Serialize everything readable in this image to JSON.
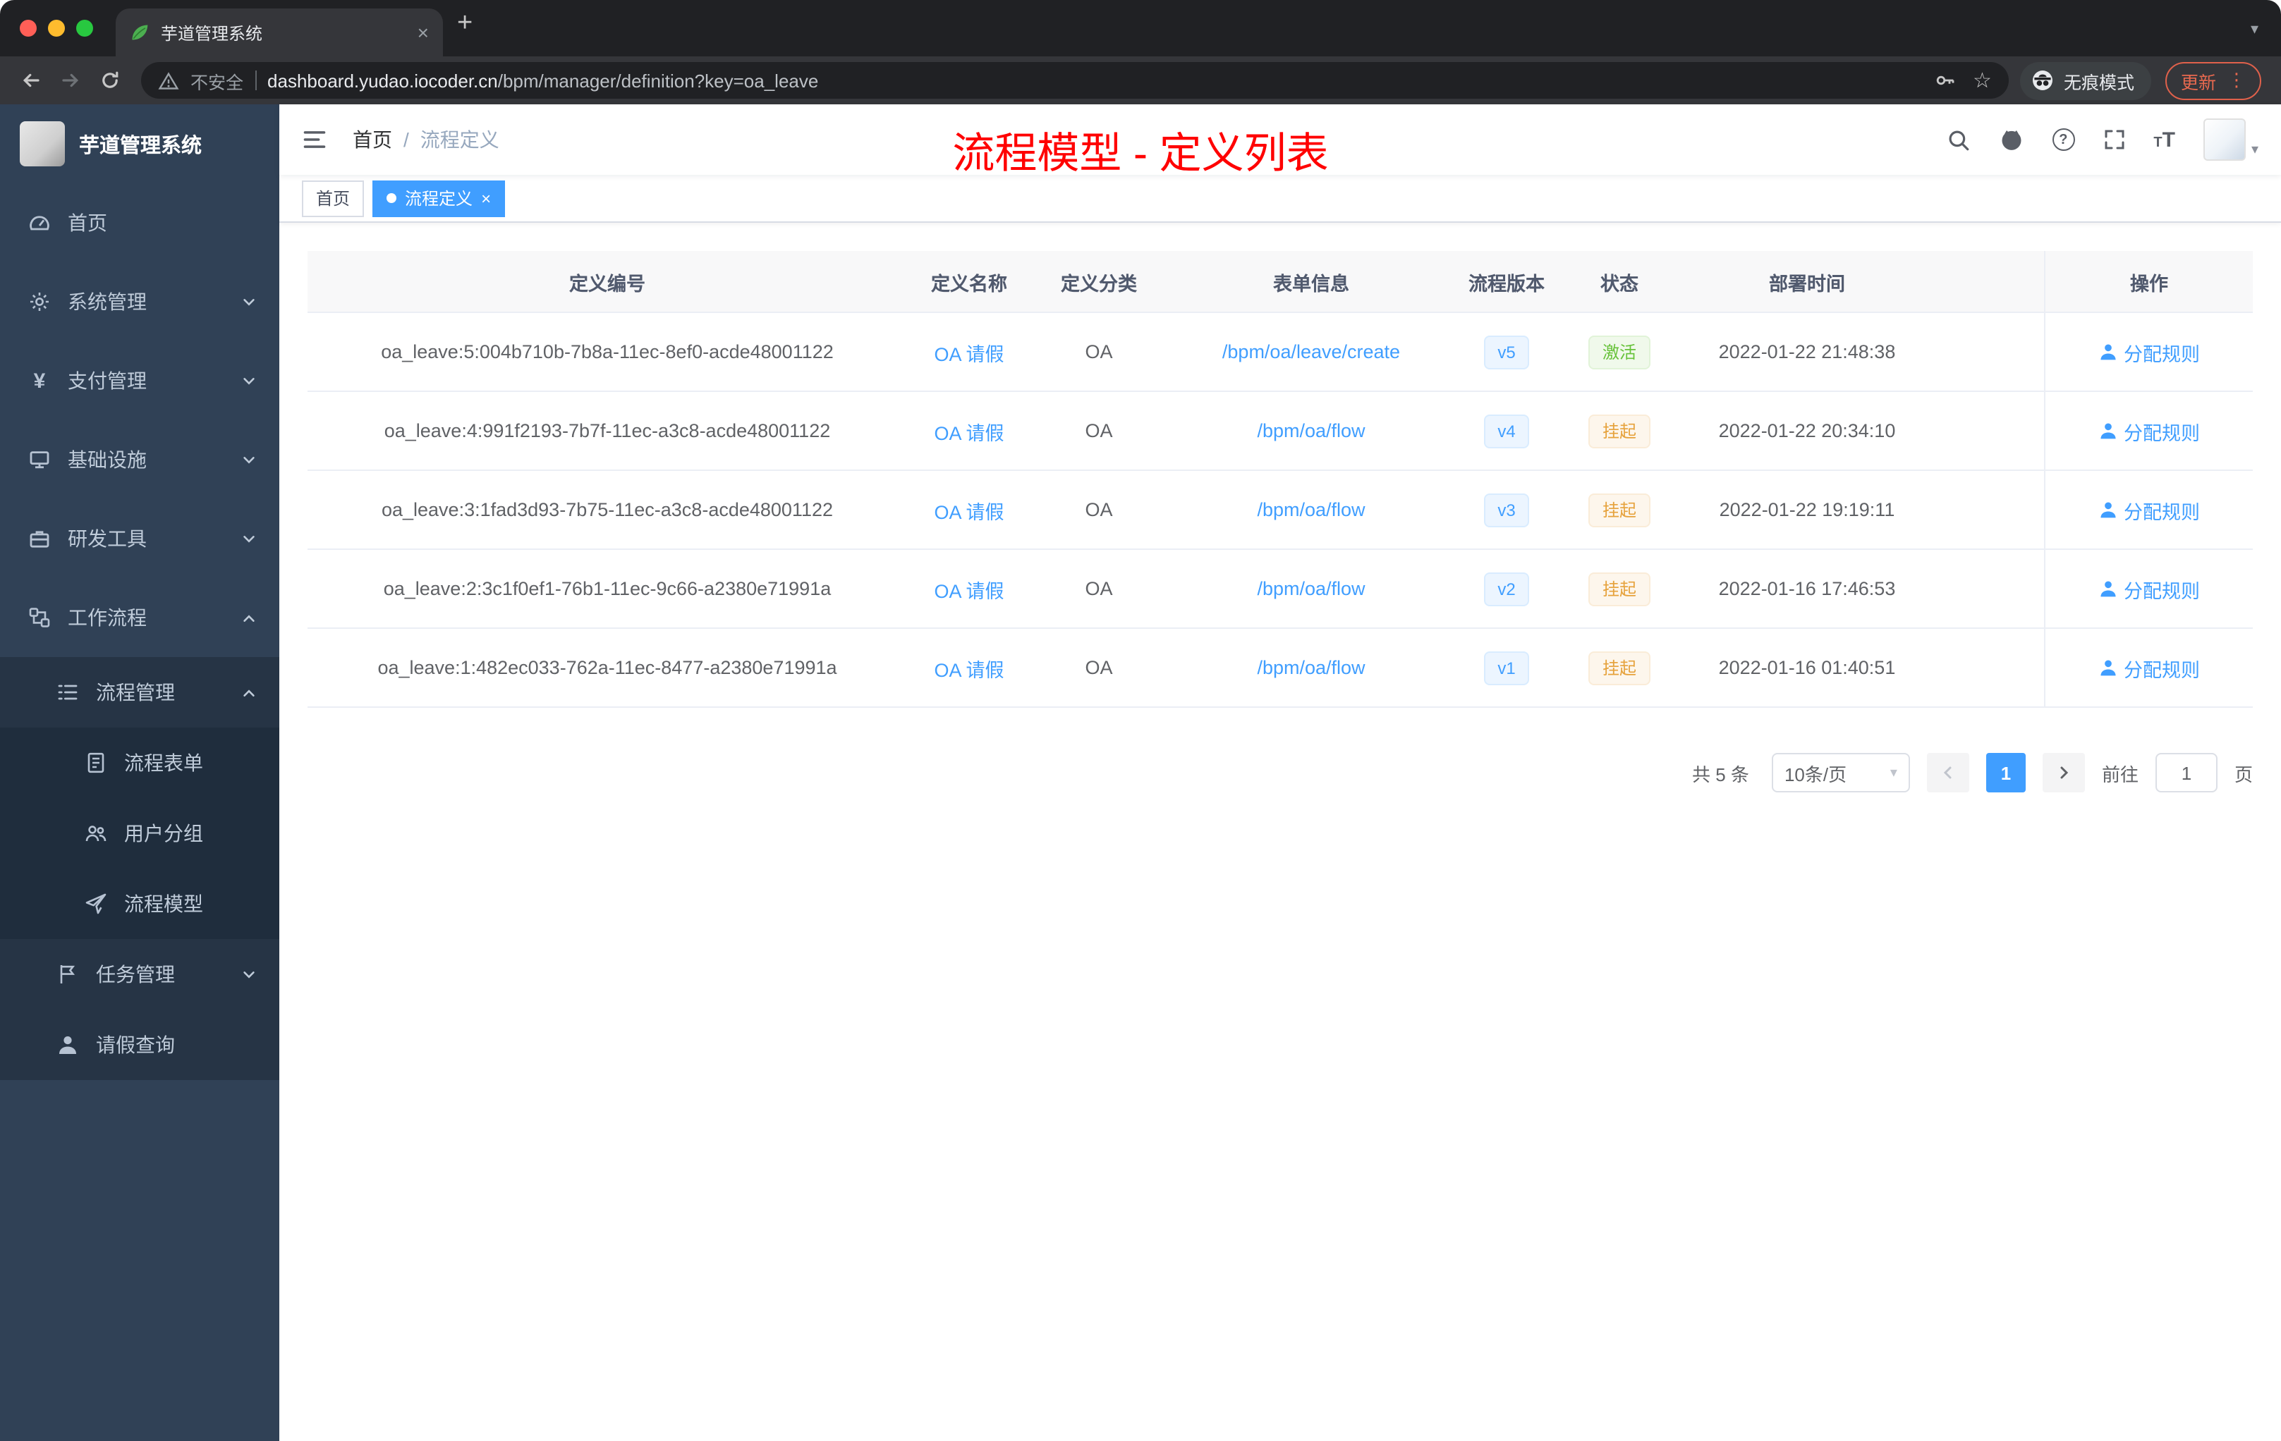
{
  "browser": {
    "tab_title": "芋道管理系统",
    "insecure_label": "不安全",
    "url_host": "dashboard.yudao.iocoder.cn",
    "url_path": "/bpm/manager/definition?key=oa_leave",
    "incognito_label": "无痕模式",
    "update_label": "更新"
  },
  "icons": {
    "close": "×",
    "plus": "+",
    "caret_down": "▾",
    "dots_vertical": "⋮",
    "star": "☆",
    "question": "?",
    "yen": "¥",
    "t_small": "T",
    "t_large": "T"
  },
  "sidebar": {
    "logo_title": "芋道管理系统",
    "menu": {
      "home": "首页",
      "system": "系统管理",
      "pay": "支付管理",
      "infra": "基础设施",
      "dev": "研发工具",
      "workflow": "工作流程",
      "process_manage": "流程管理",
      "process_form": "流程表单",
      "user_group": "用户分组",
      "process_model": "流程模型",
      "task_manage": "任务管理",
      "leave_query": "请假查询"
    }
  },
  "header": {
    "breadcrumb_home": "首页",
    "breadcrumb_sep": "/",
    "breadcrumb_current": "流程定义",
    "annotation": "流程模型 - 定义列表"
  },
  "tags": {
    "home": "首页",
    "active": "流程定义"
  },
  "table": {
    "columns": {
      "id": "定义编号",
      "name": "定义名称",
      "category": "定义分类",
      "form": "表单信息",
      "version": "流程版本",
      "status": "状态",
      "deploy_time": "部署时间",
      "actions": "操作"
    },
    "rows": [
      {
        "id": "oa_leave:5:004b710b-7b8a-11ec-8ef0-acde48001122",
        "name": "OA 请假",
        "category": "OA",
        "form": "/bpm/oa/leave/create",
        "version": "v5",
        "status": "激活",
        "deploy_time": "2022-01-22 21:48:38",
        "action": "分配规则"
      },
      {
        "id": "oa_leave:4:991f2193-7b7f-11ec-a3c8-acde48001122",
        "name": "OA 请假",
        "category": "OA",
        "form": "/bpm/oa/flow",
        "version": "v4",
        "status": "挂起",
        "deploy_time": "2022-01-22 20:34:10",
        "action": "分配规则"
      },
      {
        "id": "oa_leave:3:1fad3d93-7b75-11ec-a3c8-acde48001122",
        "name": "OA 请假",
        "category": "OA",
        "form": "/bpm/oa/flow",
        "version": "v3",
        "status": "挂起",
        "deploy_time": "2022-01-22 19:19:11",
        "action": "分配规则"
      },
      {
        "id": "oa_leave:2:3c1f0ef1-76b1-11ec-9c66-a2380e71991a",
        "name": "OA 请假",
        "category": "OA",
        "form": "/bpm/oa/flow",
        "version": "v2",
        "status": "挂起",
        "deploy_time": "2022-01-16 17:46:53",
        "action": "分配规则"
      },
      {
        "id": "oa_leave:1:482ec033-762a-11ec-8477-a2380e71991a",
        "name": "OA 请假",
        "category": "OA",
        "form": "/bpm/oa/flow",
        "version": "v1",
        "status": "挂起",
        "deploy_time": "2022-01-16 01:40:51",
        "action": "分配规则"
      }
    ]
  },
  "pagination": {
    "total": "共 5 条",
    "page_size": "10条/页",
    "current_page": "1",
    "goto_label": "前往",
    "goto_value": "1",
    "unit_label": "页"
  },
  "colors": {
    "primary": "#409eff",
    "success": "#67c23a",
    "warning": "#e6a23c",
    "annotation_red": "#ff0000",
    "sidebar_bg": "#304156"
  }
}
